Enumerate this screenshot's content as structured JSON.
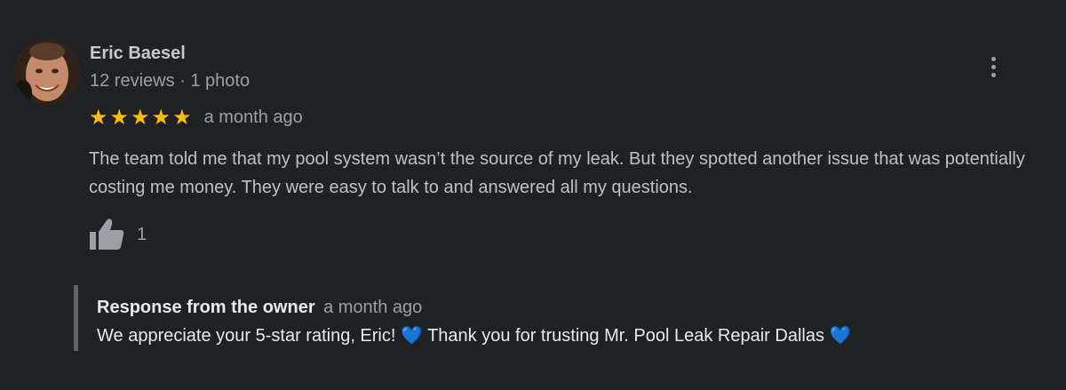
{
  "review": {
    "author_name": "Eric Baesel",
    "author_meta": "12 reviews · 1 photo",
    "avatar_icon": "profile-photo",
    "rating": 5,
    "max_rating": 5,
    "star_glyph": "★",
    "date": "a month ago",
    "text": "The team told me that my pool system wasn’t the source of my leak. But they spotted another issue that was potentially costing me money. They were easy to talk to and answered all my questions.",
    "like_icon": "thumbs-up-icon",
    "like_count": "1",
    "more_icon": "more-vert-icon"
  },
  "owner_response": {
    "label": "Response from the owner",
    "date": "a month ago",
    "text": "We appreciate your 5-star rating, Eric! 💙 Thank you for trusting Mr. Pool Leak Repair Dallas 💙"
  },
  "colors": {
    "background": "#202124",
    "star": "#fbbc04",
    "secondary_text": "#9aa0a6",
    "primary_text": "#bdc1c6",
    "response_bar": "#5f6368"
  }
}
